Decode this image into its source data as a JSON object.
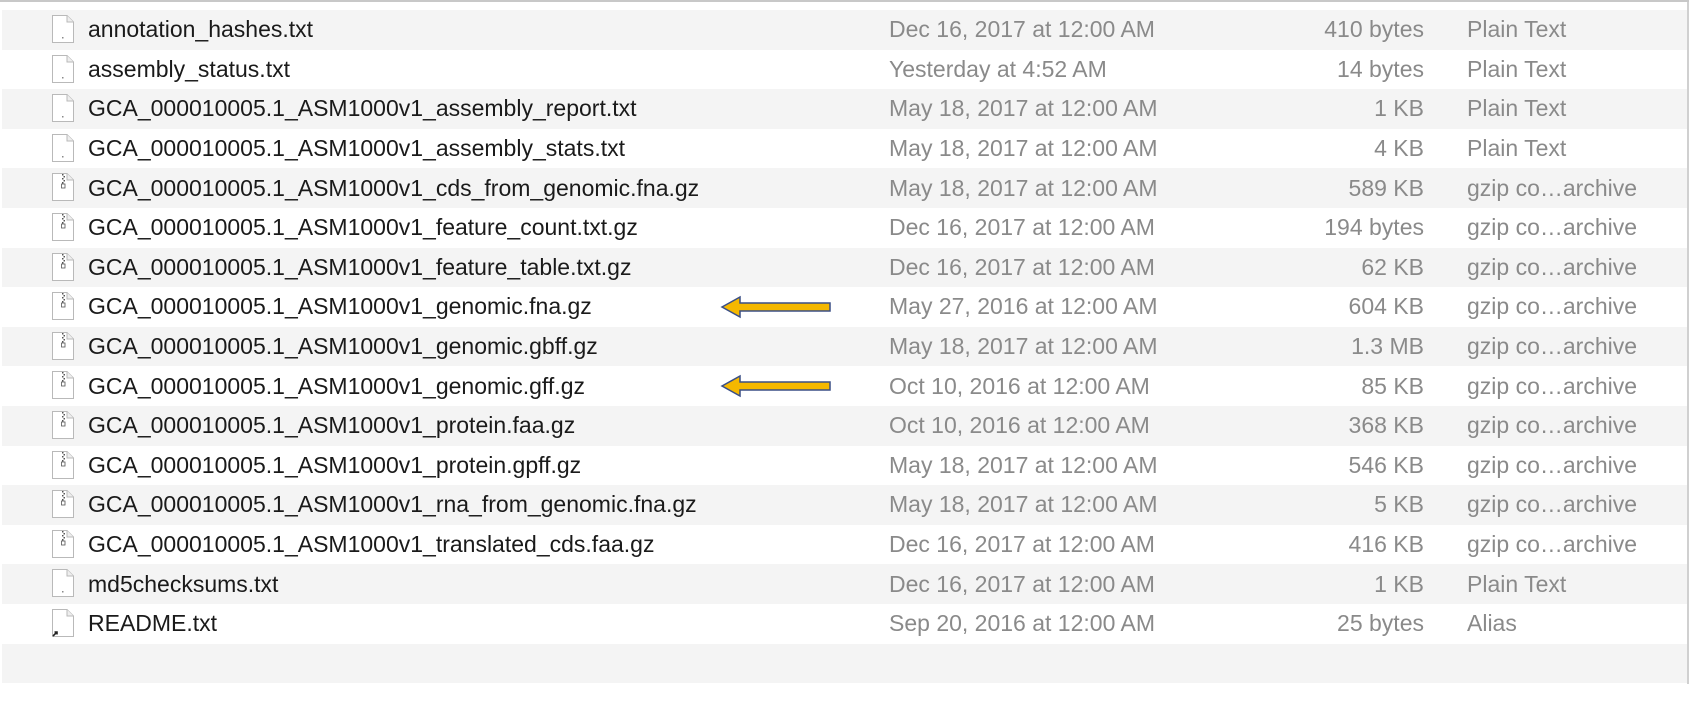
{
  "colors": {
    "stripe": "#f4f4f4",
    "name_text": "#1a1a1a",
    "meta_text": "#8a8a8a",
    "arrow_fill": "#f5b800",
    "arrow_outline": "#3a4f86"
  },
  "files": [
    {
      "name": "annotation_hashes.txt",
      "date": "Dec 16, 2017 at 12:00 AM",
      "size": "410 bytes",
      "kind": "Plain Text",
      "icon": "text-document-icon",
      "arrow": false
    },
    {
      "name": "assembly_status.txt",
      "date": "Yesterday at 4:52 AM",
      "size": "14 bytes",
      "kind": "Plain Text",
      "icon": "text-document-icon",
      "arrow": false
    },
    {
      "name": "GCA_000010005.1_ASM1000v1_assembly_report.txt",
      "date": "May 18, 2017 at 12:00 AM",
      "size": "1 KB",
      "kind": "Plain Text",
      "icon": "text-document-icon",
      "arrow": false
    },
    {
      "name": "GCA_000010005.1_ASM1000v1_assembly_stats.txt",
      "date": "May 18, 2017 at 12:00 AM",
      "size": "4 KB",
      "kind": "Plain Text",
      "icon": "text-document-icon",
      "arrow": false
    },
    {
      "name": "GCA_000010005.1_ASM1000v1_cds_from_genomic.fna.gz",
      "date": "May 18, 2017 at 12:00 AM",
      "size": "589 KB",
      "kind": "gzip co…archive",
      "icon": "archive-file-icon",
      "arrow": false
    },
    {
      "name": "GCA_000010005.1_ASM1000v1_feature_count.txt.gz",
      "date": "Dec 16, 2017 at 12:00 AM",
      "size": "194 bytes",
      "kind": "gzip co…archive",
      "icon": "archive-file-icon",
      "arrow": false
    },
    {
      "name": "GCA_000010005.1_ASM1000v1_feature_table.txt.gz",
      "date": "Dec 16, 2017 at 12:00 AM",
      "size": "62 KB",
      "kind": "gzip co…archive",
      "icon": "archive-file-icon",
      "arrow": false
    },
    {
      "name": "GCA_000010005.1_ASM1000v1_genomic.fna.gz",
      "date": "May 27, 2016 at 12:00 AM",
      "size": "604 KB",
      "kind": "gzip co…archive",
      "icon": "archive-file-icon",
      "arrow": true
    },
    {
      "name": "GCA_000010005.1_ASM1000v1_genomic.gbff.gz",
      "date": "May 18, 2017 at 12:00 AM",
      "size": "1.3 MB",
      "kind": "gzip co…archive",
      "icon": "archive-file-icon",
      "arrow": false
    },
    {
      "name": "GCA_000010005.1_ASM1000v1_genomic.gff.gz",
      "date": "Oct 10, 2016 at 12:00 AM",
      "size": "85 KB",
      "kind": "gzip co…archive",
      "icon": "archive-file-icon",
      "arrow": true
    },
    {
      "name": "GCA_000010005.1_ASM1000v1_protein.faa.gz",
      "date": "Oct 10, 2016 at 12:00 AM",
      "size": "368 KB",
      "kind": "gzip co…archive",
      "icon": "archive-file-icon",
      "arrow": false
    },
    {
      "name": "GCA_000010005.1_ASM1000v1_protein.gpff.gz",
      "date": "May 18, 2017 at 12:00 AM",
      "size": "546 KB",
      "kind": "gzip co…archive",
      "icon": "archive-file-icon",
      "arrow": false
    },
    {
      "name": "GCA_000010005.1_ASM1000v1_rna_from_genomic.fna.gz",
      "date": "May 18, 2017 at 12:00 AM",
      "size": "5 KB",
      "kind": "gzip co…archive",
      "icon": "archive-file-icon",
      "arrow": false
    },
    {
      "name": "GCA_000010005.1_ASM1000v1_translated_cds.faa.gz",
      "date": "Dec 16, 2017 at 12:00 AM",
      "size": "416 KB",
      "kind": "gzip co…archive",
      "icon": "archive-file-icon",
      "arrow": false
    },
    {
      "name": "md5checksums.txt",
      "date": "Dec 16, 2017 at 12:00 AM",
      "size": "1 KB",
      "kind": "Plain Text",
      "icon": "text-document-icon",
      "arrow": false
    },
    {
      "name": "README.txt",
      "date": "Sep 20, 2016 at 12:00 AM",
      "size": "25 bytes",
      "kind": "Alias",
      "icon": "alias-file-icon",
      "arrow": false
    }
  ]
}
